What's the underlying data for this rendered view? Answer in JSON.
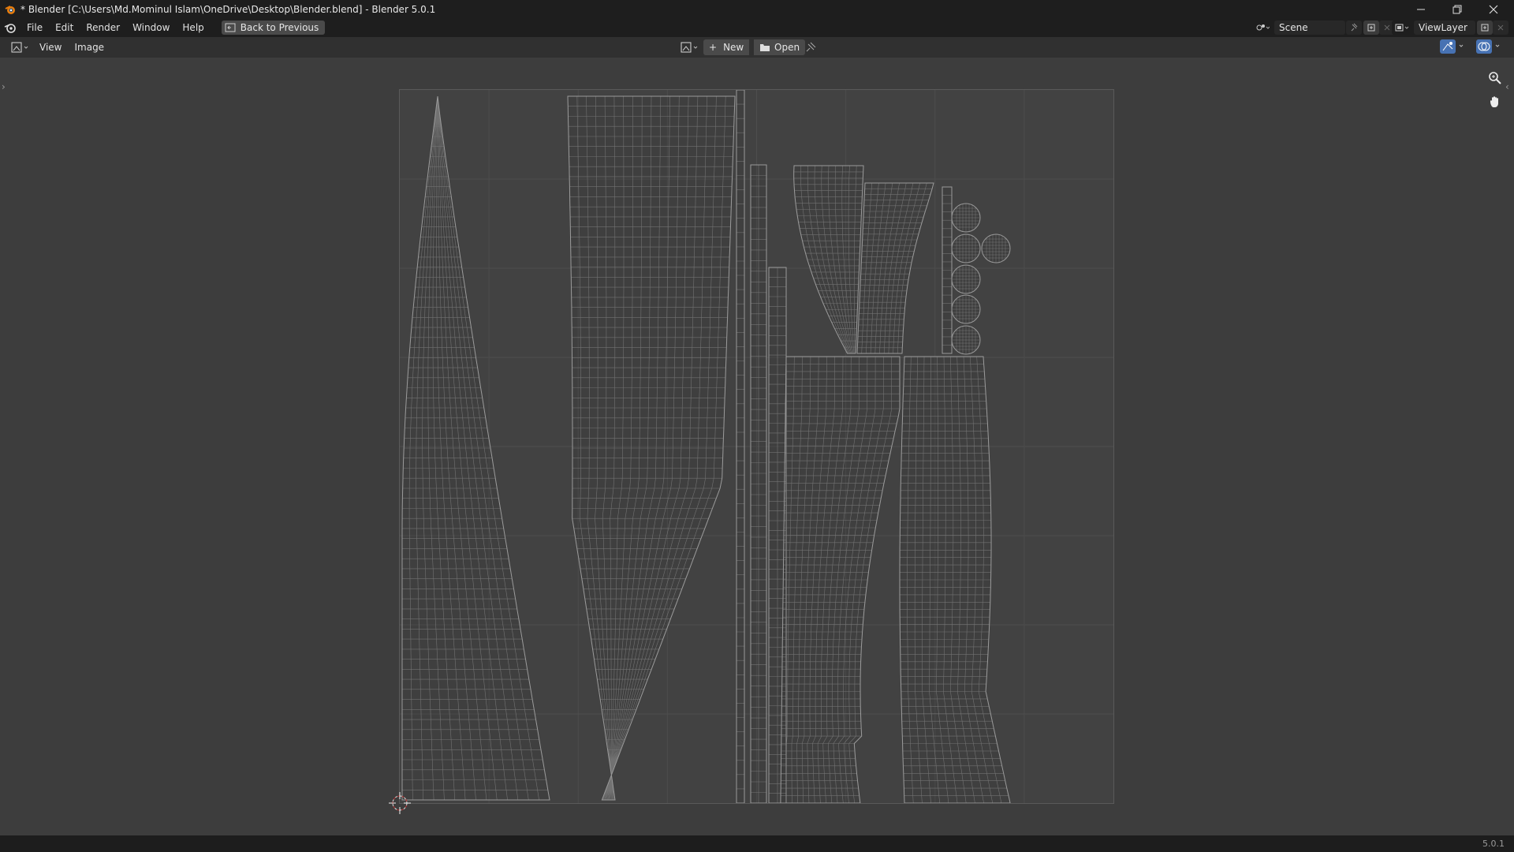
{
  "window": {
    "title": "* Blender [C:\\Users\\Md.Mominul Islam\\OneDrive\\Desktop\\Blender.blend] - Blender 5.0.1",
    "controls": [
      "minimize-icon",
      "restore-icon",
      "close-icon"
    ]
  },
  "menu": {
    "items": [
      "File",
      "Edit",
      "Render",
      "Window",
      "Help"
    ],
    "back_button": "Back to Previous"
  },
  "scene": {
    "label": "Scene"
  },
  "view_layer": {
    "label": "ViewLayer"
  },
  "editor": {
    "editor_type_icon": "image-editor-icon",
    "menus": [
      "View",
      "Image"
    ],
    "new_label": "New",
    "open_label": "Open",
    "pin_icon": "pin-icon"
  },
  "tools": {
    "zoom_icon": "zoom-icon",
    "pan_icon": "hand-pan-icon"
  },
  "colors": {
    "background": "#3d3d3d",
    "uv_space": "#424242",
    "wire": "#8a8a8a",
    "bar": "#1e1e1e"
  },
  "status": {
    "version": "5.0.1"
  }
}
